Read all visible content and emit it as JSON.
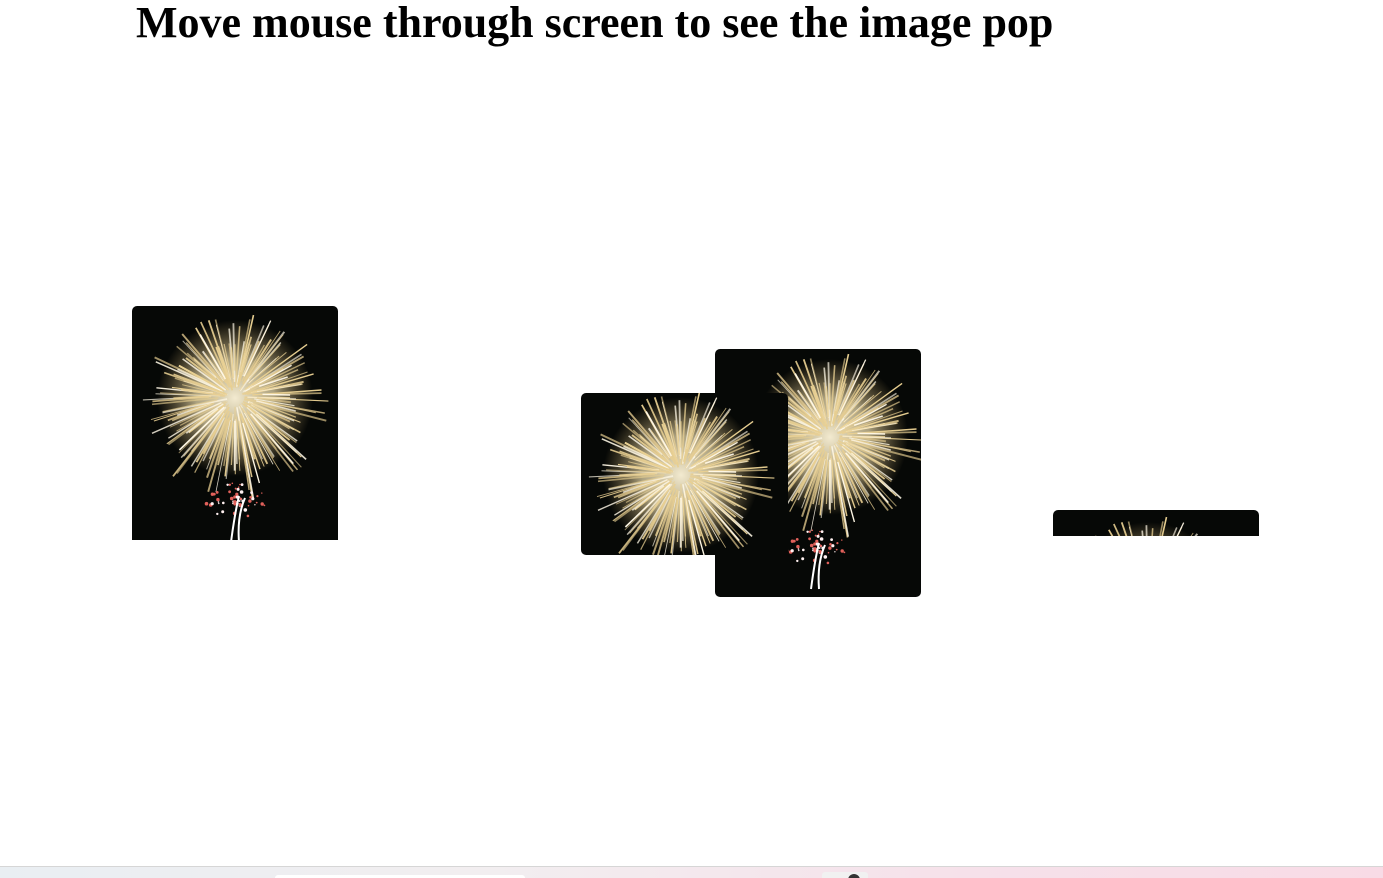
{
  "page": {
    "heading": "Move mouse through screen to see the image pop"
  },
  "gallery": {
    "images": [
      {
        "subject": "fireworks-burst"
      },
      {
        "subject": "fireworks-burst"
      },
      {
        "subject": "fireworks-burst"
      },
      {
        "subject": "fireworks-burst"
      }
    ]
  },
  "colors": {
    "background": "#ffffff",
    "heading": "#000000",
    "sky": "#060806",
    "spark_gold": "#f3e3b4",
    "spark_red": "#e0605a"
  },
  "taskbar": {
    "icon": "app-icon"
  }
}
